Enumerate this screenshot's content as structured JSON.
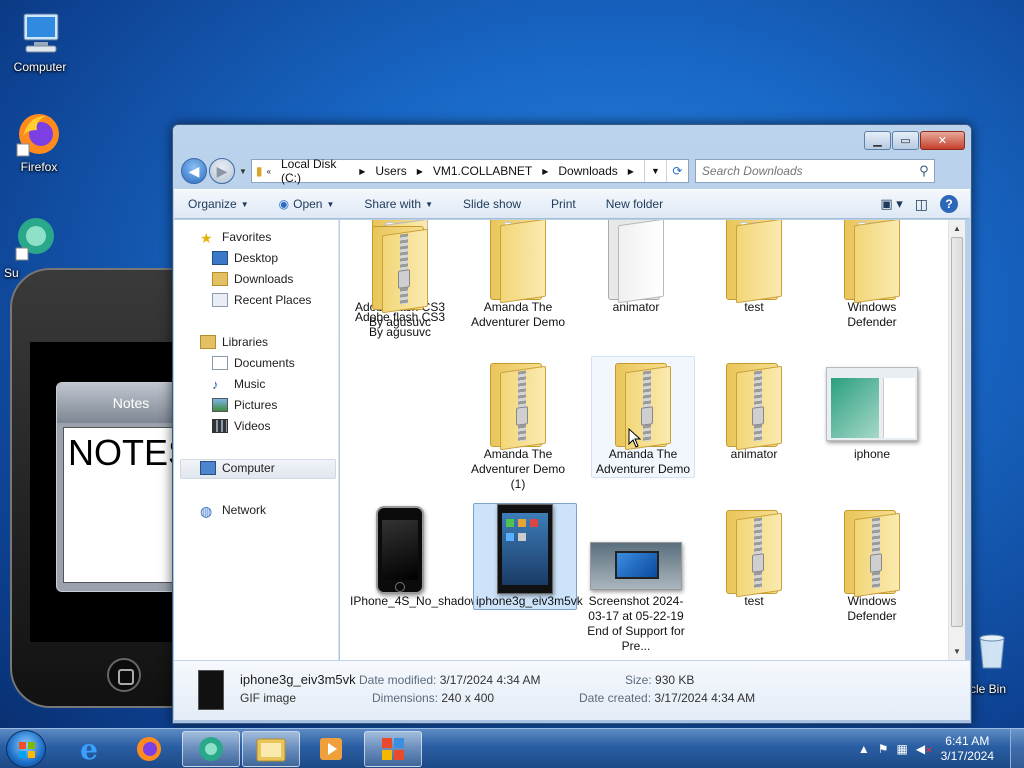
{
  "desktop": {
    "icons": [
      {
        "label": "Computer"
      },
      {
        "label": "Firefox"
      },
      {
        "label": "Su"
      },
      {
        "label": "cle Bin"
      }
    ]
  },
  "phone": {
    "app_title": "Notes",
    "note_text": "NOTES"
  },
  "explorer": {
    "breadcrumb": [
      "Local Disk (C:)",
      "Users",
      "VM1.COLLABNET",
      "Downloads"
    ],
    "search_placeholder": "Search Downloads",
    "commands": [
      "Organize",
      "Open",
      "Share with",
      "Slide show",
      "Print",
      "New folder"
    ],
    "nav": {
      "favorites": "Favorites",
      "desktop": "Desktop",
      "downloads": "Downloads",
      "recent": "Recent Places",
      "libraries": "Libraries",
      "documents": "Documents",
      "music": "Music",
      "pictures": "Pictures",
      "videos": "Videos",
      "computer": "Computer",
      "network": "Network"
    },
    "items": [
      {
        "label": "Adobe flash CS3 By agusuvc",
        "type": "folder"
      },
      {
        "label": "Amanda The Adventurer Demo",
        "type": "folder"
      },
      {
        "label": "animator",
        "type": "folder-docs"
      },
      {
        "label": "test",
        "type": "folder"
      },
      {
        "label": "Windows Defender",
        "type": "folder"
      },
      {
        "label": "Adobe flash CS3 By agusuvc",
        "type": "zip"
      },
      {
        "label": "Amanda The Adventurer Demo (1)",
        "type": "zip"
      },
      {
        "label": "Amanda The Adventurer Demo",
        "type": "zip"
      },
      {
        "label": "animator",
        "type": "zip"
      },
      {
        "label": "iphone",
        "type": "image-window"
      },
      {
        "label": "IPhone_4S_No_shadow",
        "type": "image-phone"
      },
      {
        "label": "iphone3g_eiv3m5vk",
        "type": "image-phone-screen"
      },
      {
        "label": "Screenshot 2024-03-17 at 05-22-19 End of Support for Pre...",
        "type": "image-laptop"
      },
      {
        "label": "test",
        "type": "zip"
      },
      {
        "label": "Windows Defender",
        "type": "zip"
      }
    ],
    "details": {
      "name": "iphone3g_eiv3m5vk",
      "type": "GIF image",
      "date_modified_label": "Date modified:",
      "date_modified": "3/17/2024 4:34 AM",
      "dimensions_label": "Dimensions:",
      "dimensions": "240 x 400",
      "size_label": "Size:",
      "size": "930 KB",
      "date_created_label": "Date created:",
      "date_created": "3/17/2024 4:34 AM"
    }
  },
  "taskbar": {
    "time": "6:41 AM",
    "date": "3/17/2024"
  },
  "colors": {
    "selection": "#cce3fa",
    "desktop": "#1866c4",
    "folder": "#f2d678"
  }
}
